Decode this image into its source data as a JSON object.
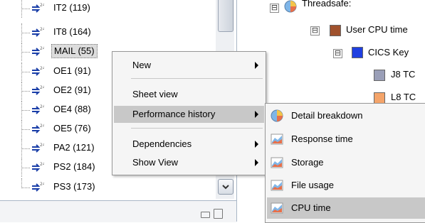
{
  "left_tree": {
    "items": [
      {
        "label": "IT2 (119)"
      },
      {
        "label": "IT8 (164)"
      },
      {
        "label": "MAIL (55)",
        "selected": true
      },
      {
        "label": "OE1 (91)"
      },
      {
        "label": "OE2 (91)"
      },
      {
        "label": "OE4 (88)"
      },
      {
        "label": "OE5 (76)"
      },
      {
        "label": "PA2 (121)"
      },
      {
        "label": "PS2 (184)"
      },
      {
        "label": "PS3 (173)"
      }
    ]
  },
  "right_tree": {
    "threadsafe_label": "Threadsafe:",
    "user_cpu_label": "User CPU time",
    "cics_key_label": "CICS Key",
    "j8_label": "J8 TC",
    "l8_label": "L8 TC",
    "expander_symbol": "⊟",
    "colors": {
      "user_cpu": "#a0522d",
      "cics_key": "#1f3fe0",
      "j8": "#9a9fb8",
      "l8": "#f4a46a"
    }
  },
  "context_menu": {
    "items": [
      {
        "label": "New",
        "has_submenu": true
      },
      {
        "label": "Sheet view",
        "has_submenu": false
      },
      {
        "label": "Performance history",
        "has_submenu": true,
        "highlighted": true
      },
      {
        "label": "Dependencies",
        "has_submenu": true
      },
      {
        "label": "Show View",
        "has_submenu": true
      }
    ]
  },
  "submenu": {
    "items": [
      {
        "label": "Detail breakdown",
        "icon": "pie-chart-icon"
      },
      {
        "label": "Response time",
        "icon": "area-chart-icon"
      },
      {
        "label": "Storage",
        "icon": "area-chart-icon"
      },
      {
        "label": "File usage",
        "icon": "area-chart-icon"
      },
      {
        "label": "CPU time",
        "icon": "area-chart-icon",
        "highlighted": true
      }
    ]
  }
}
